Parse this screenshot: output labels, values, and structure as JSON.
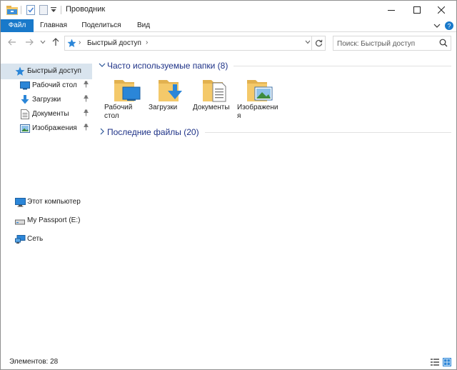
{
  "window": {
    "title": "Проводник"
  },
  "ribbon": {
    "tabs": [
      {
        "label": "Файл",
        "active": true
      },
      {
        "label": "Главная"
      },
      {
        "label": "Поделиться"
      },
      {
        "label": "Вид"
      }
    ]
  },
  "address": {
    "crumbs": [
      "Быстрый доступ"
    ],
    "search_placeholder": "Поиск: Быстрый доступ"
  },
  "navigation": {
    "quick_access_label": "Быстрый доступ",
    "pinned": [
      {
        "label": "Рабочий стол",
        "icon": "desktop-icon"
      },
      {
        "label": "Загрузки",
        "icon": "downloads-icon"
      },
      {
        "label": "Документы",
        "icon": "documents-icon"
      },
      {
        "label": "Изображения",
        "icon": "pictures-icon"
      }
    ],
    "this_pc": "Этот компьютер",
    "drive": "My Passport (E:)",
    "network": "Сеть"
  },
  "content": {
    "frequent_header": "Часто используемые папки (8)",
    "recent_header": "Последние файлы (20)",
    "folders": [
      {
        "label": "Рабочий стол",
        "icon": "desktop-folder-icon"
      },
      {
        "label": "Загрузки",
        "icon": "downloads-folder-icon"
      },
      {
        "label": "Документы",
        "icon": "documents-folder-icon"
      },
      {
        "label": "Изображения",
        "icon": "pictures-folder-icon"
      }
    ]
  },
  "status": {
    "items_text": "Элементов: 28"
  },
  "colors": {
    "accent": "#1979ca",
    "selected_bg": "#d9e4ee",
    "group_header": "#1e3287",
    "folder": "#f4c96a"
  }
}
